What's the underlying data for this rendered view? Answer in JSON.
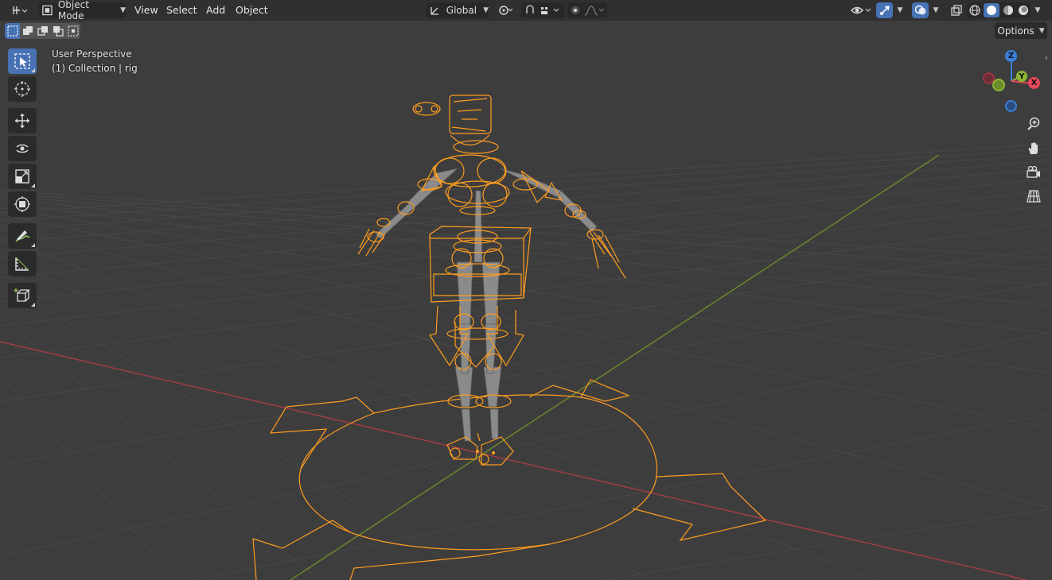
{
  "header": {
    "mode": "Object Mode",
    "menus": [
      "View",
      "Select",
      "Add",
      "Object"
    ],
    "transform_orientation": "Global"
  },
  "toolbar_row": {
    "options_label": "Options"
  },
  "viewport": {
    "view_name": "User Perspective",
    "collection_info": "(1) Collection | rig"
  },
  "gizmo": {
    "axes": [
      "Z",
      "Y",
      "X"
    ],
    "colors": {
      "x": "#e8485a",
      "y": "#8bb733",
      "z": "#3b7fd9",
      "x_neg": "#9c3541",
      "y_neg": "#6b8a2a",
      "z_neg": "#2e5f9e"
    }
  },
  "theme": {
    "accent": "#4772b3",
    "selection_orange": "#ff9d1f",
    "grid_red": "#a73d45",
    "grid_green": "#6a8a2b"
  },
  "icons": [
    "editor-type-icon",
    "object-mode-icon",
    "transform-icon",
    "pivot-icon",
    "snap-icon",
    "proportional-icon",
    "visibility-icon",
    "gizmo-icon",
    "overlay-icon",
    "xray-icon",
    "wireframe-shading-icon",
    "solid-shading-icon",
    "material-shading-icon",
    "rendered-shading-icon",
    "select-box-icon",
    "cursor-icon",
    "move-icon",
    "rotate-icon",
    "scale-icon",
    "transform-tool-icon",
    "annotate-icon",
    "measure-icon",
    "add-cube-icon",
    "zoom-icon",
    "hand-icon",
    "camera-icon",
    "grid-view-icon"
  ]
}
